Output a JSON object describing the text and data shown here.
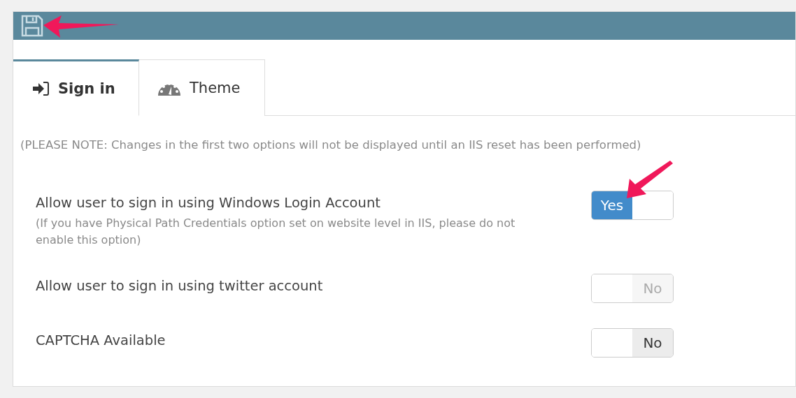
{
  "tabs": [
    {
      "label": "Sign in",
      "selected": true
    },
    {
      "label": "Theme",
      "selected": false
    }
  ],
  "note": "(PLEASE NOTE: Changes in the first two options will not be displayed until an IIS reset has been performed)",
  "options": [
    {
      "label": "Allow user to sign in using Windows Login Account",
      "hint": "(If you have Physical Path Credentials option set on website level in IIS, please do not enable this option)",
      "on": true,
      "disabled": false,
      "state_text": "Yes"
    },
    {
      "label": "Allow user to sign in using twitter account",
      "on": false,
      "disabled": true,
      "state_text": "No"
    },
    {
      "label": "CAPTCHA Available",
      "on": false,
      "disabled": false,
      "state_text": "No"
    }
  ]
}
